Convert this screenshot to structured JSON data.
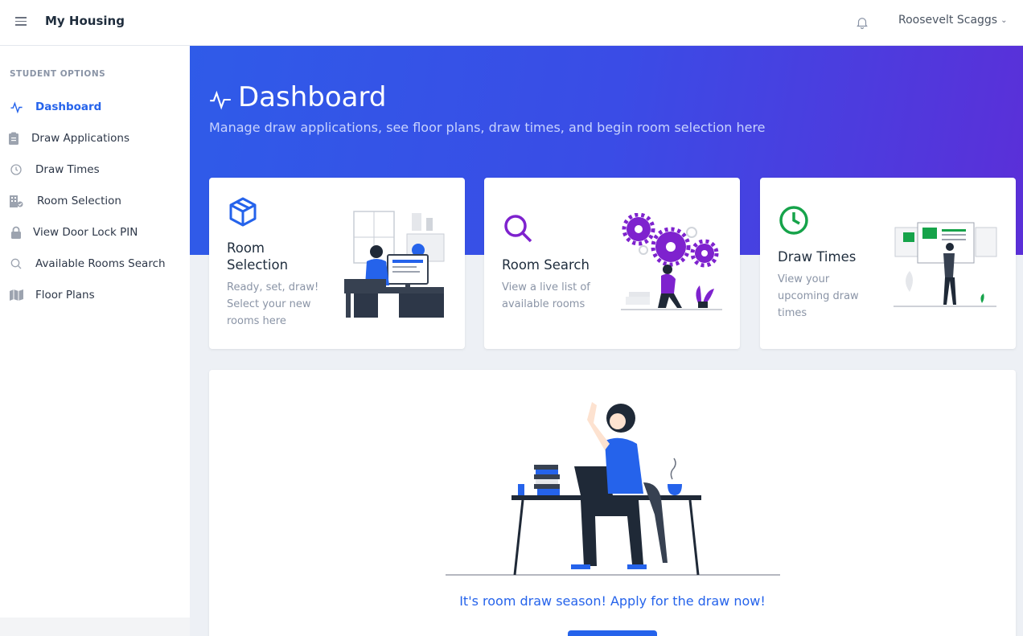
{
  "app": {
    "title": "My Housing"
  },
  "user": {
    "name": "Roosevelt Scaggs"
  },
  "sidebar": {
    "heading": "STUDENT OPTIONS",
    "items": [
      {
        "label": "Dashboard",
        "icon": "activity-icon",
        "active": true
      },
      {
        "label": "Draw Applications",
        "icon": "clipboard-icon"
      },
      {
        "label": "Draw Times",
        "icon": "clock-icon"
      },
      {
        "label": "Room Selection",
        "icon": "building-icon"
      },
      {
        "label": "View Door Lock PIN",
        "icon": "lock-icon"
      },
      {
        "label": "Available Rooms Search",
        "icon": "search-icon"
      },
      {
        "label": "Floor Plans",
        "icon": "map-icon"
      }
    ]
  },
  "hero": {
    "title": "Dashboard",
    "subtitle": "Manage draw applications, see floor plans, draw times, and begin room selection here"
  },
  "cards": [
    {
      "title_line1": "Room",
      "title_line2": "Selection",
      "desc_lines": [
        "Ready, set, draw!",
        "Select your new",
        "rooms here"
      ],
      "icon": "box-icon",
      "accent": "#2563eb"
    },
    {
      "title": "Room Search",
      "desc_lines": [
        "View a live list of",
        "available rooms"
      ],
      "icon": "search-icon",
      "accent": "#7e22ce"
    },
    {
      "title": "Draw Times",
      "desc_lines": [
        "View your",
        "upcoming draw",
        "times"
      ],
      "icon": "clock-icon",
      "accent": "#16a34a"
    }
  ],
  "banner": {
    "message": "It's room draw season! Apply for the draw now!",
    "button_label": ""
  },
  "colors": {
    "primary": "#2563eb",
    "purple": "#7e22ce",
    "green": "#16a34a"
  }
}
